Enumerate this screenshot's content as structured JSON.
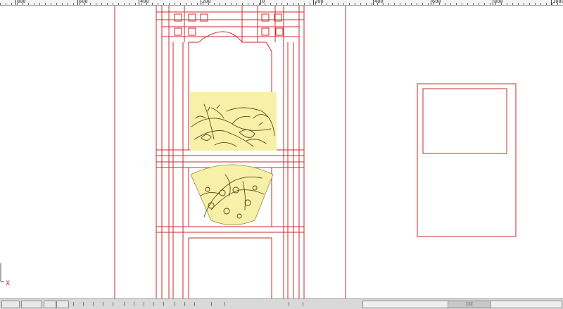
{
  "ruler": {
    "labels": [
      "800",
      "600",
      "400",
      "200",
      "0",
      "200",
      "400",
      "600",
      "800",
      "1000"
    ]
  },
  "canvas": {
    "line_color": "#cc2a2a",
    "panel_fill": "#f7f0a8",
    "carving_stroke": "#5a4a1a"
  },
  "axis": {
    "x_label": "X"
  },
  "statusbar": {
    "scroll_label": "III"
  }
}
